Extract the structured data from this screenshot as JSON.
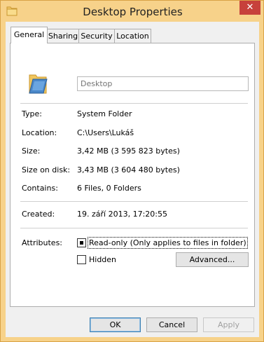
{
  "window": {
    "title": "Desktop Properties",
    "close_glyph": "✕"
  },
  "tabs": [
    {
      "label": "General",
      "active": true
    },
    {
      "label": "Sharing",
      "active": false
    },
    {
      "label": "Security",
      "active": false
    },
    {
      "label": "Location",
      "active": false
    }
  ],
  "general": {
    "name_placeholder": "Desktop",
    "type_label": "Type:",
    "type_value": "System Folder",
    "location_label": "Location:",
    "location_value": "C:\\Users\\Lukáš",
    "size_label": "Size:",
    "size_value": "3,42 MB (3 595 823 bytes)",
    "size_on_disk_label": "Size on disk:",
    "size_on_disk_value": "3,43 MB (3 604 480 bytes)",
    "contains_label": "Contains:",
    "contains_value": "6 Files, 0 Folders",
    "created_label": "Created:",
    "created_value": "19. září 2013, 17:20:55",
    "attributes_label": "Attributes:",
    "readonly_label": "Read-only (Only applies to files in folder)",
    "readonly_state": "indeterminate",
    "hidden_label": "Hidden",
    "hidden_checked": false,
    "advanced_label": "Advanced..."
  },
  "buttons": {
    "ok": "OK",
    "cancel": "Cancel",
    "apply": "Apply"
  },
  "colors": {
    "frame": "#f7d28a",
    "close": "#c7413b",
    "default_button_border": "#3c7fb1"
  },
  "icons": {
    "title": "folder-icon",
    "main": "folder-icon",
    "close": "close-icon"
  }
}
